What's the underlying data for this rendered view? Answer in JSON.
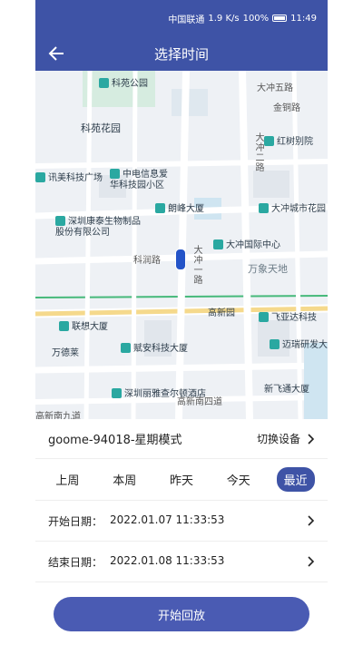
{
  "status_bar": {
    "carrier": "中国联通",
    "net_speed": "1.9 K/s",
    "battery": "100%",
    "time": "11:49"
  },
  "header": {
    "title": "选择时间"
  },
  "map": {
    "pois": [
      "科苑公园",
      "科苑花园",
      "讯美科技广场",
      "中电信息爱华科技园小区",
      "深圳康泰生物制品股份有限公司",
      "朗峰大厦",
      "大冲国际中心",
      "大冲城市花园",
      "红树别院",
      "联想大厦",
      "万德莱",
      "赋安科技大厦",
      "深圳丽雅查尔顿酒店",
      "飞亚达科技",
      "迈瑞研发大楼",
      "新飞通大厦",
      "高新园"
    ],
    "roads": [
      "大冲五路",
      "金铜路",
      "大冲二路",
      "科润路",
      "大冲一路",
      "高新南四道",
      "高新南九道"
    ],
    "areas": [
      "万象天地"
    ]
  },
  "device": {
    "name": "goome-94018-星期模式",
    "switch_label": "切换设备"
  },
  "tabs": [
    {
      "label": "上周"
    },
    {
      "label": "本周"
    },
    {
      "label": "昨天"
    },
    {
      "label": "今天"
    },
    {
      "label": "最近",
      "active": true
    }
  ],
  "start_date": {
    "label": "开始日期：",
    "value": "2022.01.07 11:33:53"
  },
  "end_date": {
    "label": "结束日期：",
    "value": "2022.01.08 11:33:53"
  },
  "start_button": "开始回放",
  "colors": {
    "primary": "#3e53a6",
    "poi": "#2aa8a1"
  }
}
